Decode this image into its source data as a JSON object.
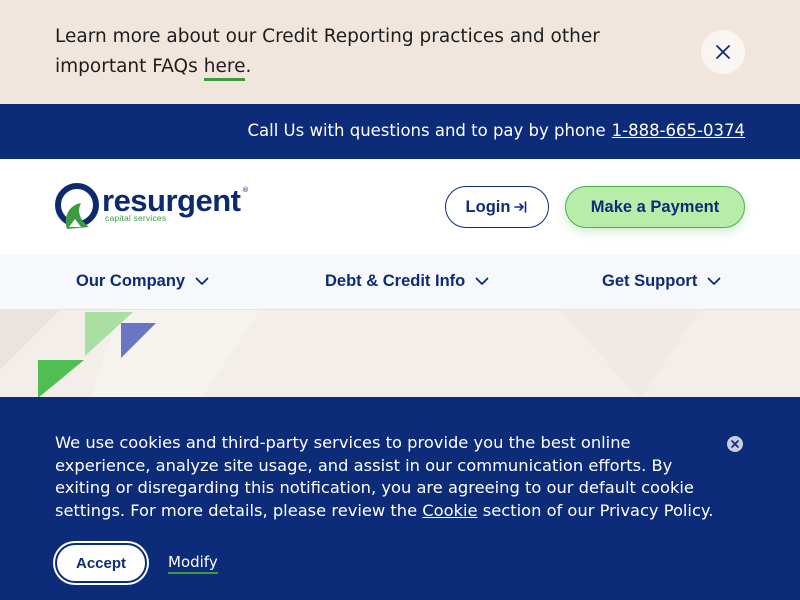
{
  "notice": {
    "text": "Learn more about our Credit Reporting practices and other important FAQs",
    "link": "here",
    "after_link": "."
  },
  "phonebar": {
    "text": "Call Us with questions and to pay by phone",
    "phone": "1-888-665-0374"
  },
  "header": {
    "logo_word": "resurgent",
    "logo_sub": "capital services",
    "logo_reg": "®",
    "login_label": "Login",
    "pay_label": "Make a Payment"
  },
  "nav": {
    "items": [
      {
        "label": "Our Company"
      },
      {
        "label": "Debt & Credit Info"
      },
      {
        "label": "Get Support"
      }
    ]
  },
  "cookie": {
    "text_before": "We use cookies and third-party services to provide you the best online experience, analyze site usage, and assist in our communication efforts. By exiting or disregarding this notification, you are agreeing to our default cookie settings. For more details, please review the",
    "link": "Cookie",
    "text_after": "section of our Privacy Policy.",
    "accept_label": "Accept",
    "modify_label": "Modify"
  },
  "colors": {
    "navy": "#0c2b78",
    "green": "#3c9b3d",
    "light_green": "#b8eda9",
    "cream": "#f1e6de"
  }
}
